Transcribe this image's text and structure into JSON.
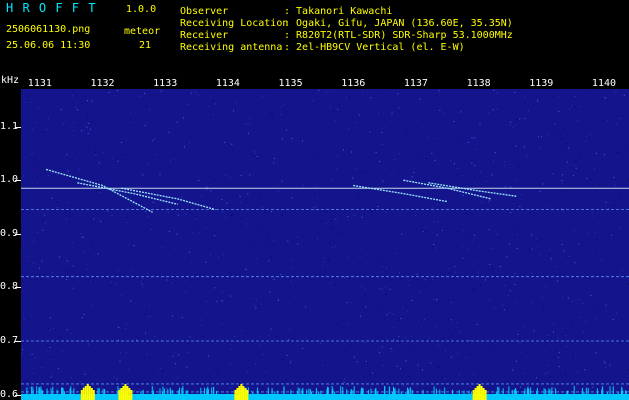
{
  "header": {
    "app_name": "H R O F F T",
    "version": "1.0.0",
    "filename": "2506061130.png",
    "datetime": "25.06.06 11:30",
    "meteor_label": "meteor",
    "meteor_count": "21",
    "info": [
      {
        "label": "Observer",
        "value": ": Takanori Kawachi"
      },
      {
        "label": "Receiving Location",
        "value": ": Ogaki, Gifu, JAPAN (136.60E, 35.35N)"
      },
      {
        "label": "Receiver",
        "value": ": R820T2(RTL-SDR) SDR-Sharp 53.1000MHz"
      },
      {
        "label": "Receiving antenna",
        "value": ": 2el-HB9CV Vertical (el. E-W)"
      }
    ]
  },
  "chart_data": {
    "type": "heatmap",
    "ylabel": "kHz",
    "x_ticks": [
      "1131",
      "1132",
      "1133",
      "1134",
      "1135",
      "1136",
      "1137",
      "1138",
      "1139",
      "1140"
    ],
    "y_ticks": [
      "1.1",
      "1.0",
      "0.9",
      "0.8",
      "0.7",
      "0.6"
    ],
    "ylim": [
      0.59,
      1.17
    ],
    "xlim": [
      1130.7,
      1140.4
    ],
    "carrier_lines_khz": [
      0.985,
      0.945,
      0.82,
      0.7,
      0.62,
      0.605
    ],
    "meteor_traces": [
      {
        "x": [
          1131.1,
          1132.0,
          1132.8
        ],
        "y": [
          1.02,
          0.99,
          0.94
        ]
      },
      {
        "x": [
          1131.6,
          1132.5,
          1133.2
        ],
        "y": [
          0.995,
          0.975,
          0.955
        ]
      },
      {
        "x": [
          1132.3,
          1133.2,
          1133.8
        ],
        "y": [
          0.985,
          0.965,
          0.945
        ]
      },
      {
        "x": [
          1136.0,
          1136.8,
          1137.5
        ],
        "y": [
          0.99,
          0.975,
          0.96
        ]
      },
      {
        "x": [
          1136.8,
          1137.5,
          1138.2
        ],
        "y": [
          1.0,
          0.985,
          0.965
        ]
      },
      {
        "x": [
          1137.2,
          1138.0,
          1138.6
        ],
        "y": [
          0.995,
          0.98,
          0.97
        ]
      }
    ],
    "bottom_signal_bursts": [
      1131.75,
      1132.35,
      1134.2,
      1138.0
    ],
    "colors": {
      "background": "#14148c",
      "trace": "#9ce8ff",
      "carrier": "#e0f8ff",
      "signal": "#ffff00",
      "noise": "#00c8ff"
    }
  }
}
